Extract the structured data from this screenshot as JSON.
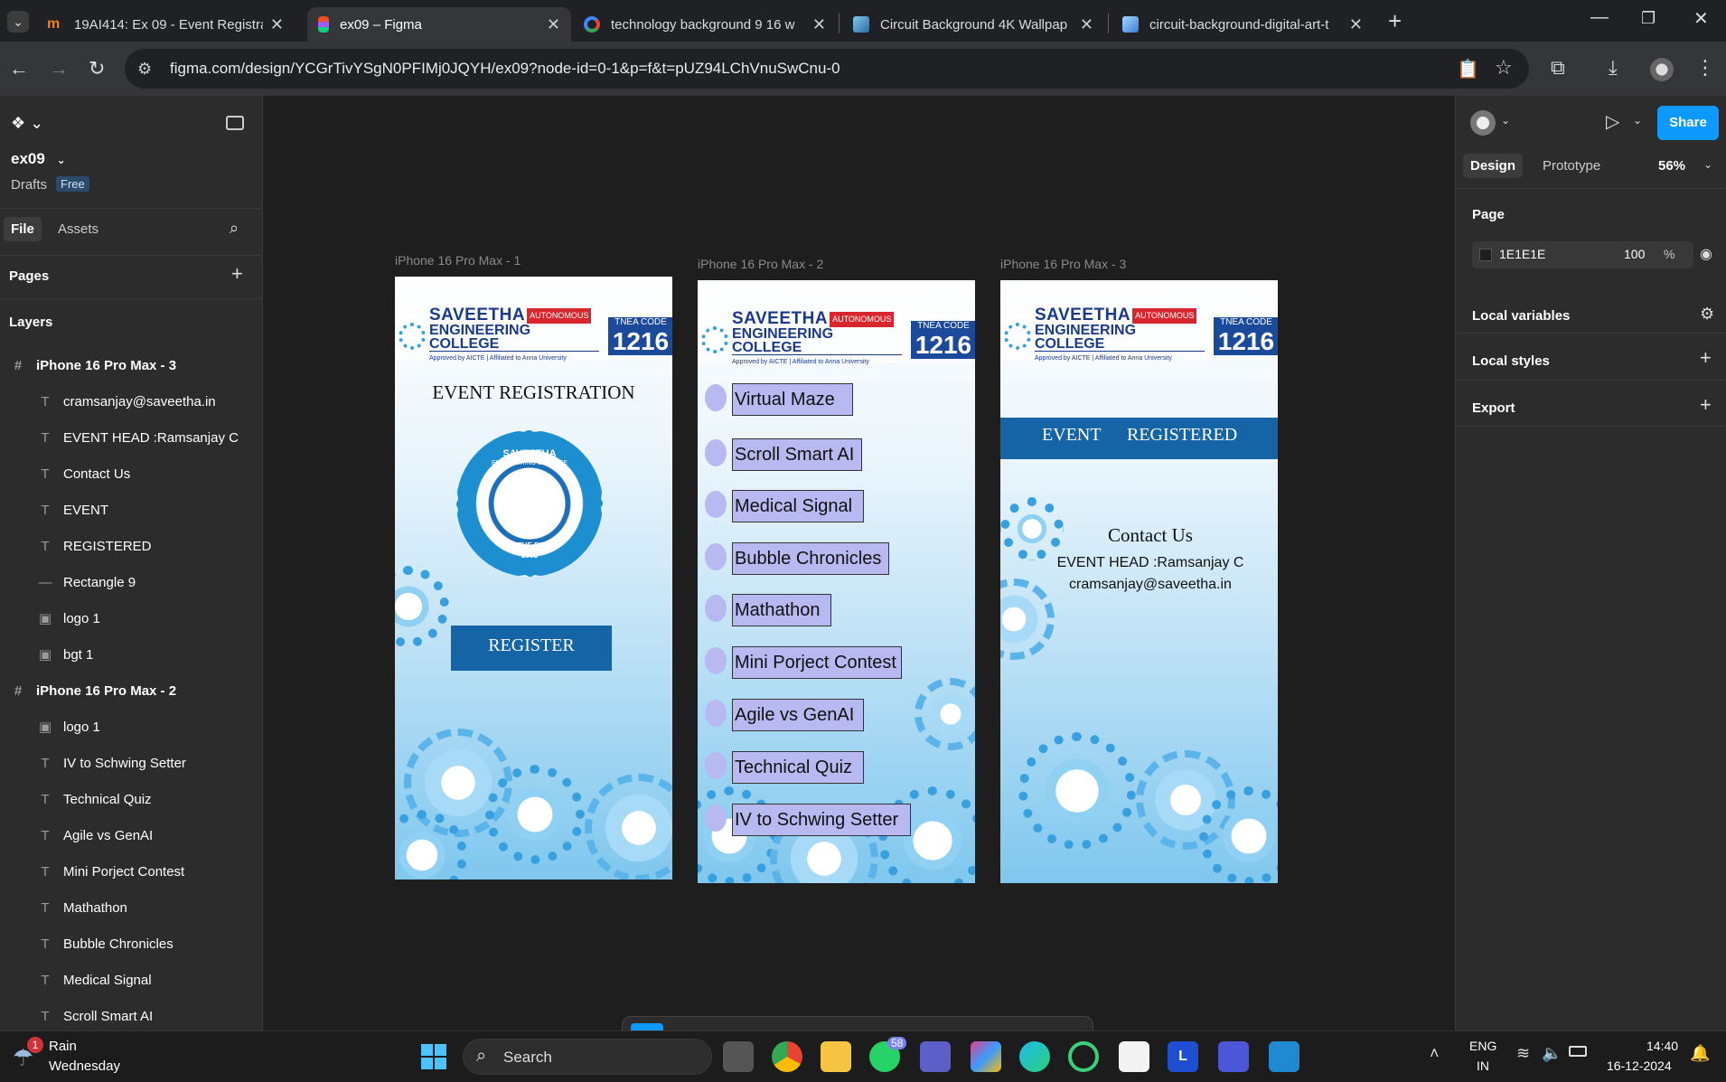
{
  "browser": {
    "tabs": [
      {
        "title": "19AI414: Ex 09 - Event Registrat",
        "active": false
      },
      {
        "title": "ex09 – Figma",
        "active": true
      },
      {
        "title": "technology background 9 16 w",
        "active": false
      },
      {
        "title": "Circuit Background 4K Wallpap",
        "active": false
      },
      {
        "title": "circuit-background-digital-art-t",
        "active": false
      }
    ],
    "new_tab": "+",
    "url": "figma.com/design/YCGrTivYSgN0PFIMj0JQYH/ex09?node-id=0-1&p=f&t=pUZ94LChVnuSwCnu-0"
  },
  "figma": {
    "file_name": "ex09",
    "drafts": "Drafts",
    "plan_badge": "Free",
    "tab_file": "File",
    "tab_assets": "Assets",
    "pages_label": "Pages",
    "layers_label": "Layers",
    "layers": [
      {
        "name": "iPhone 16 Pro Max - 3",
        "icon": "#",
        "kind": "frame"
      },
      {
        "name": "cramsanjay@saveetha.in",
        "icon": "T",
        "kind": "text"
      },
      {
        "name": "EVENT HEAD :Ramsanjay C",
        "icon": "T",
        "kind": "text"
      },
      {
        "name": "Contact Us",
        "icon": "T",
        "kind": "text"
      },
      {
        "name": "EVENT",
        "icon": "T",
        "kind": "text"
      },
      {
        "name": "REGISTERED",
        "icon": "T",
        "kind": "text"
      },
      {
        "name": "Rectangle 9",
        "icon": "—",
        "kind": "rect"
      },
      {
        "name": "logo 1",
        "icon": "▣",
        "kind": "image"
      },
      {
        "name": "bgt 1",
        "icon": "▣",
        "kind": "image"
      },
      {
        "name": "iPhone 16 Pro Max - 2",
        "icon": "#",
        "kind": "frame"
      },
      {
        "name": "logo 1",
        "icon": "▣",
        "kind": "image"
      },
      {
        "name": "IV to Schwing Setter",
        "icon": "T",
        "kind": "text"
      },
      {
        "name": "Technical Quiz",
        "icon": "T",
        "kind": "text"
      },
      {
        "name": "Agile vs GenAI",
        "icon": "T",
        "kind": "text"
      },
      {
        "name": "Mini Porject Contest",
        "icon": "T",
        "kind": "text"
      },
      {
        "name": "Mathathon",
        "icon": "T",
        "kind": "text"
      },
      {
        "name": "Bubble Chronicles",
        "icon": "T",
        "kind": "text"
      },
      {
        "name": "Medical Signal",
        "icon": "T",
        "kind": "text"
      },
      {
        "name": "Scroll Smart AI",
        "icon": "T",
        "kind": "text"
      }
    ],
    "right": {
      "share": "Share",
      "tab_design": "Design",
      "tab_prototype": "Prototype",
      "zoom": "56%",
      "page_label": "Page",
      "bg_color": "1E1E1E",
      "bg_opacity": "100",
      "percent": "%",
      "local_variables": "Local variables",
      "local_styles": "Local styles",
      "export": "Export"
    },
    "canvas_bg": "#1e1e1e",
    "frames": [
      {
        "label": "iPhone 16 Pro Max - 1"
      },
      {
        "label": "iPhone 16 Pro Max - 2"
      },
      {
        "label": "iPhone 16 Pro Max - 3"
      }
    ],
    "logo": {
      "name1": "SAVEETHA",
      "auto": "AUTONOMOUS",
      "name2": "ENGINEERING COLLEGE",
      "sub": "Approved by AICTE | Affiliated to Anna University",
      "code_t": "TNEA CODE",
      "code_n": "1216"
    },
    "frame1": {
      "title": "EVENT REGISTRATION",
      "seal_top": "SAVEETHA",
      "seal_sub": "ENGINEERING COLLEGE",
      "seal_motto": "BE THE BEST",
      "seal_year": "2001",
      "button": "REGISTER"
    },
    "frame2": {
      "events": [
        "Virtual Maze",
        "Scroll Smart AI",
        "Medical Signal",
        "Bubble Chronicles",
        "Mathathon",
        "Mini Porject Contest",
        "Agile vs GenAI",
        "Technical Quiz",
        "IV to Schwing Setter"
      ]
    },
    "frame3": {
      "banner_a": "EVENT",
      "banner_b": "REGISTERED",
      "contact": "Contact Us",
      "head": "EVENT HEAD :Ramsanjay C",
      "email": "cramsanjay@saveetha.in"
    }
  },
  "taskbar": {
    "weather_badge": "1",
    "weather": "Rain",
    "day": "Wednesday",
    "search": "Search",
    "whatsapp_badge": "58",
    "lang1": "ENG",
    "lang2": "IN",
    "time": "14:40",
    "date": "16-12-2024"
  },
  "colors": {
    "accent": "#0d99ff",
    "banner": "#1565a6",
    "event_fill": "#b7b9f0"
  }
}
